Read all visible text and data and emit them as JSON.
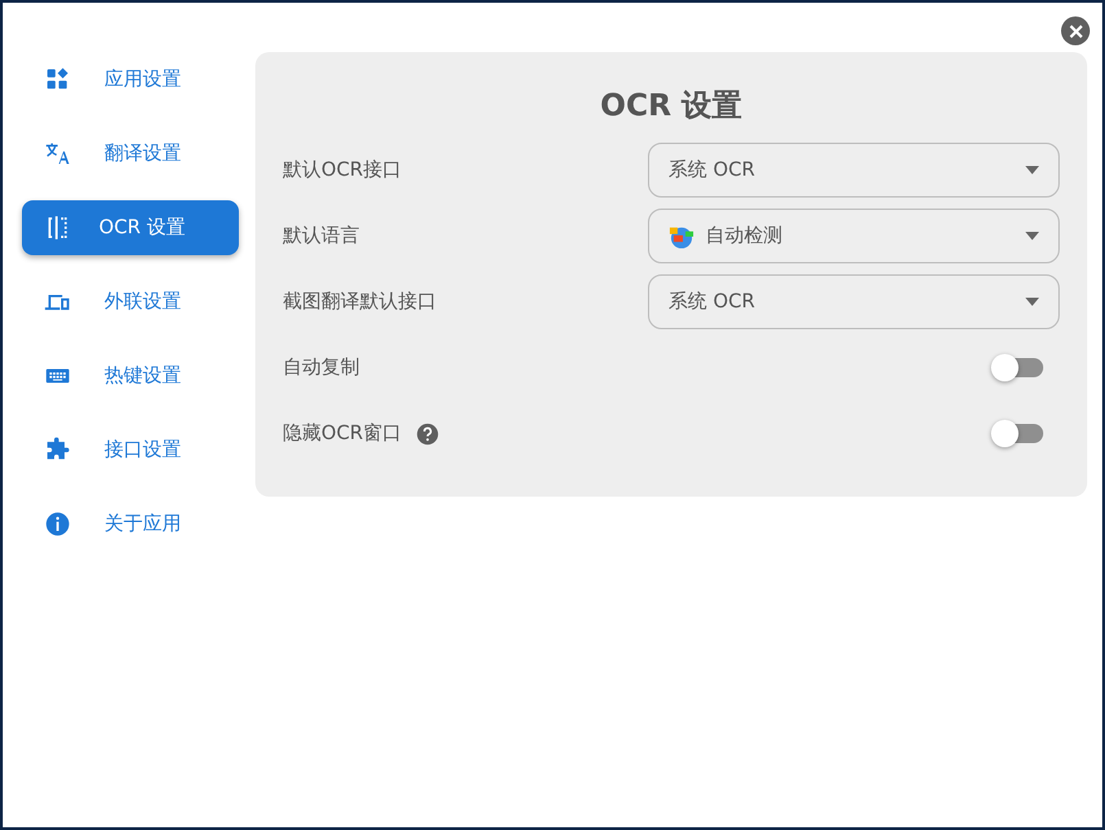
{
  "sidebar": {
    "items": [
      {
        "label": "应用设置",
        "selected": false
      },
      {
        "label": "翻译设置",
        "selected": false
      },
      {
        "label": "OCR 设置",
        "selected": true
      },
      {
        "label": "外联设置",
        "selected": false
      },
      {
        "label": "热键设置",
        "selected": false
      },
      {
        "label": "接口设置",
        "selected": false
      },
      {
        "label": "关于应用",
        "selected": false
      }
    ]
  },
  "panel": {
    "title": "OCR 设置",
    "settings": [
      {
        "kind": "select",
        "label": "默认OCR接口",
        "value": "系统 OCR"
      },
      {
        "kind": "select",
        "label": "默认语言",
        "value": "自动检测"
      },
      {
        "kind": "select",
        "label": "截图翻译默认接口",
        "value": "系统 OCR"
      },
      {
        "kind": "toggle",
        "label": "自动复制",
        "on": false
      },
      {
        "kind": "toggle",
        "label": "隐藏OCR窗口",
        "on": false,
        "help": true
      }
    ]
  }
}
